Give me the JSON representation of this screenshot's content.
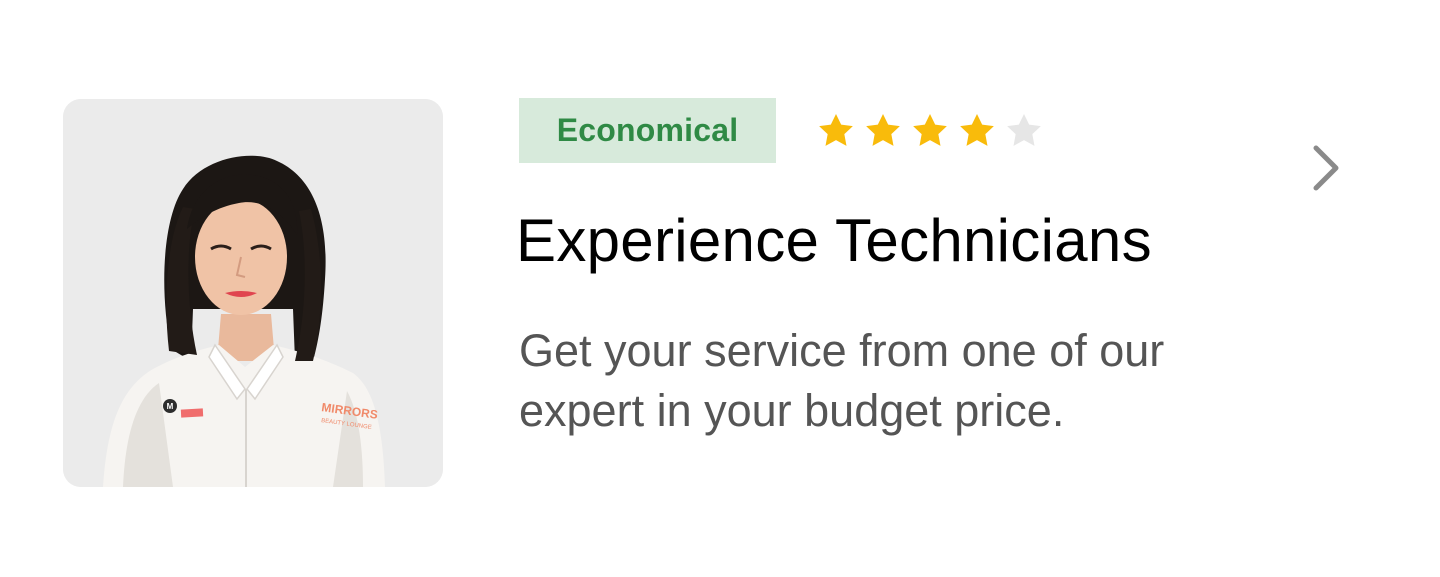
{
  "card": {
    "badge_label": "Economical",
    "rating": {
      "value": 4,
      "max": 5,
      "filled_color": "#f9bb0b",
      "empty_color": "#e6e6e6"
    },
    "title": "Experience Technicians",
    "description": "Get your service from one of our expert in your budget price.",
    "photo": {
      "uniform_brand_text": "MIRRORS",
      "uniform_sub_text": "BEAUTY LOUNGE",
      "logo_letter": "M"
    },
    "chevron_icon": "chevron-right-icon"
  },
  "colors": {
    "badge_bg": "#d7eadb",
    "badge_text": "#2f8a45",
    "title": "#000000",
    "description": "#555555",
    "photo_bg": "#ebebeb",
    "chevron": "#8a8a8a"
  }
}
